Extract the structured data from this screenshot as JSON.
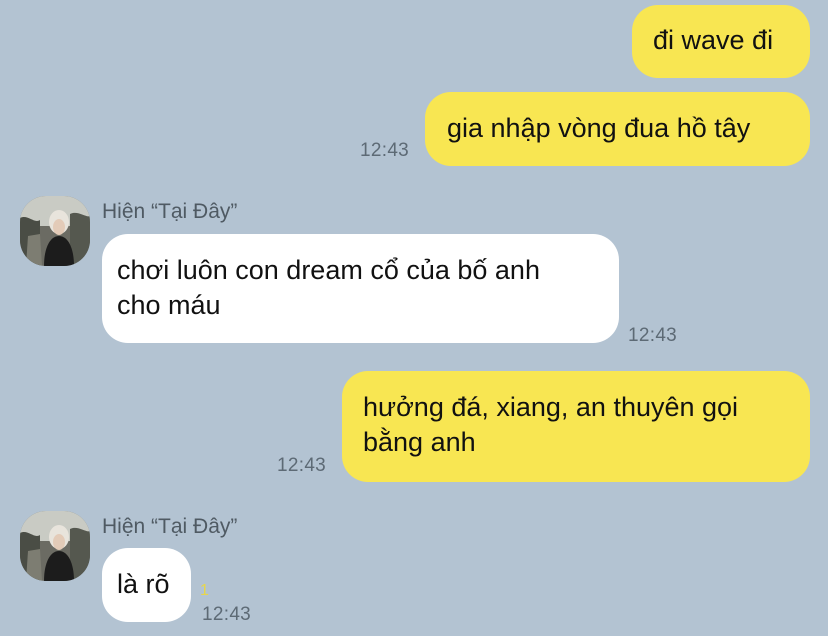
{
  "messages": [
    {
      "direction": "outgoing",
      "text": "đi wave đi"
    },
    {
      "direction": "outgoing",
      "text": "gia nhập vòng đua hồ tây",
      "time": "12:43"
    },
    {
      "direction": "incoming",
      "sender": "Hiện “Tại Đây”",
      "lines": [
        "chơi luôn con dream cổ của bố anh",
        "cho máu"
      ],
      "time": "12:43"
    },
    {
      "direction": "outgoing",
      "lines": [
        "hưởng đá, xiang, an thuyên gọi",
        "bằng anh"
      ],
      "time": "12:43"
    },
    {
      "direction": "incoming",
      "sender": "Hiện “Tại Đây”",
      "text": "là rõ",
      "time": "12:43",
      "unread_count": "1"
    }
  ],
  "colors": {
    "background": "#b3c3d2",
    "outgoing_bubble": "#f8e652",
    "incoming_bubble": "#ffffff",
    "unread_count": "#e8d64a"
  },
  "icons": {
    "avatar": "profile-photo-avatar"
  }
}
